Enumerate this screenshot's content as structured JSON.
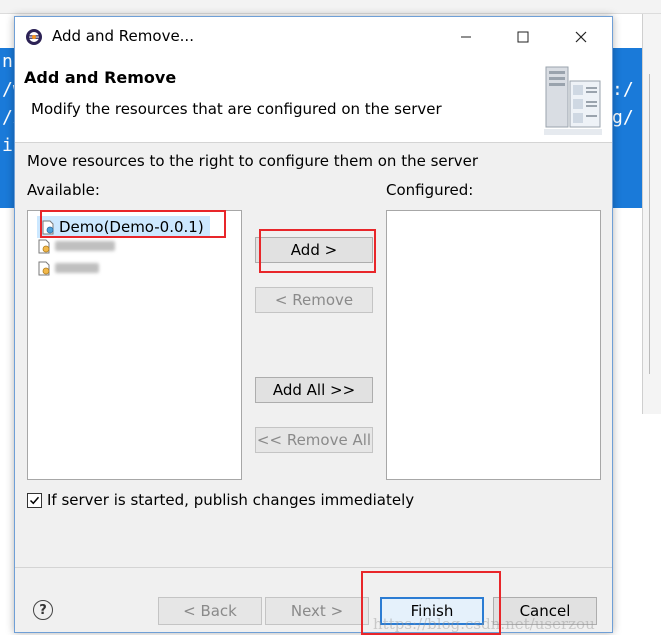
{
  "dialog": {
    "title": "Add and Remove...",
    "window_controls": [
      "minimize-icon",
      "maximize-icon",
      "close-icon"
    ],
    "header_title": "Add and Remove",
    "header_subtitle": "Modify the resources that are configured on the server",
    "instruction": "Move resources to the right to configure them on the server",
    "available_label": "Available:",
    "configured_label": "Configured:"
  },
  "available": [
    {
      "label": "Demo(Demo-0.0.1)",
      "selected": true
    },
    {
      "label": "",
      "blurred": true
    },
    {
      "label": "",
      "blurred": true
    }
  ],
  "configured": [],
  "buttons": {
    "add": "Add >",
    "remove": "< Remove",
    "add_all": "Add All >>",
    "remove_all": "<< Remove All"
  },
  "publish_checkbox": {
    "label": "If server is started, publish changes immediately",
    "checked": true
  },
  "footer": {
    "back": "< Back",
    "next": "Next >",
    "finish": "Finish",
    "cancel": "Cancel"
  },
  "watermark": "https://blog.csdn.net/userzou",
  "colors": {
    "highlight": "#e8262a",
    "selection": "#cce8ff",
    "default_button_border": "#2b7cd3"
  }
}
